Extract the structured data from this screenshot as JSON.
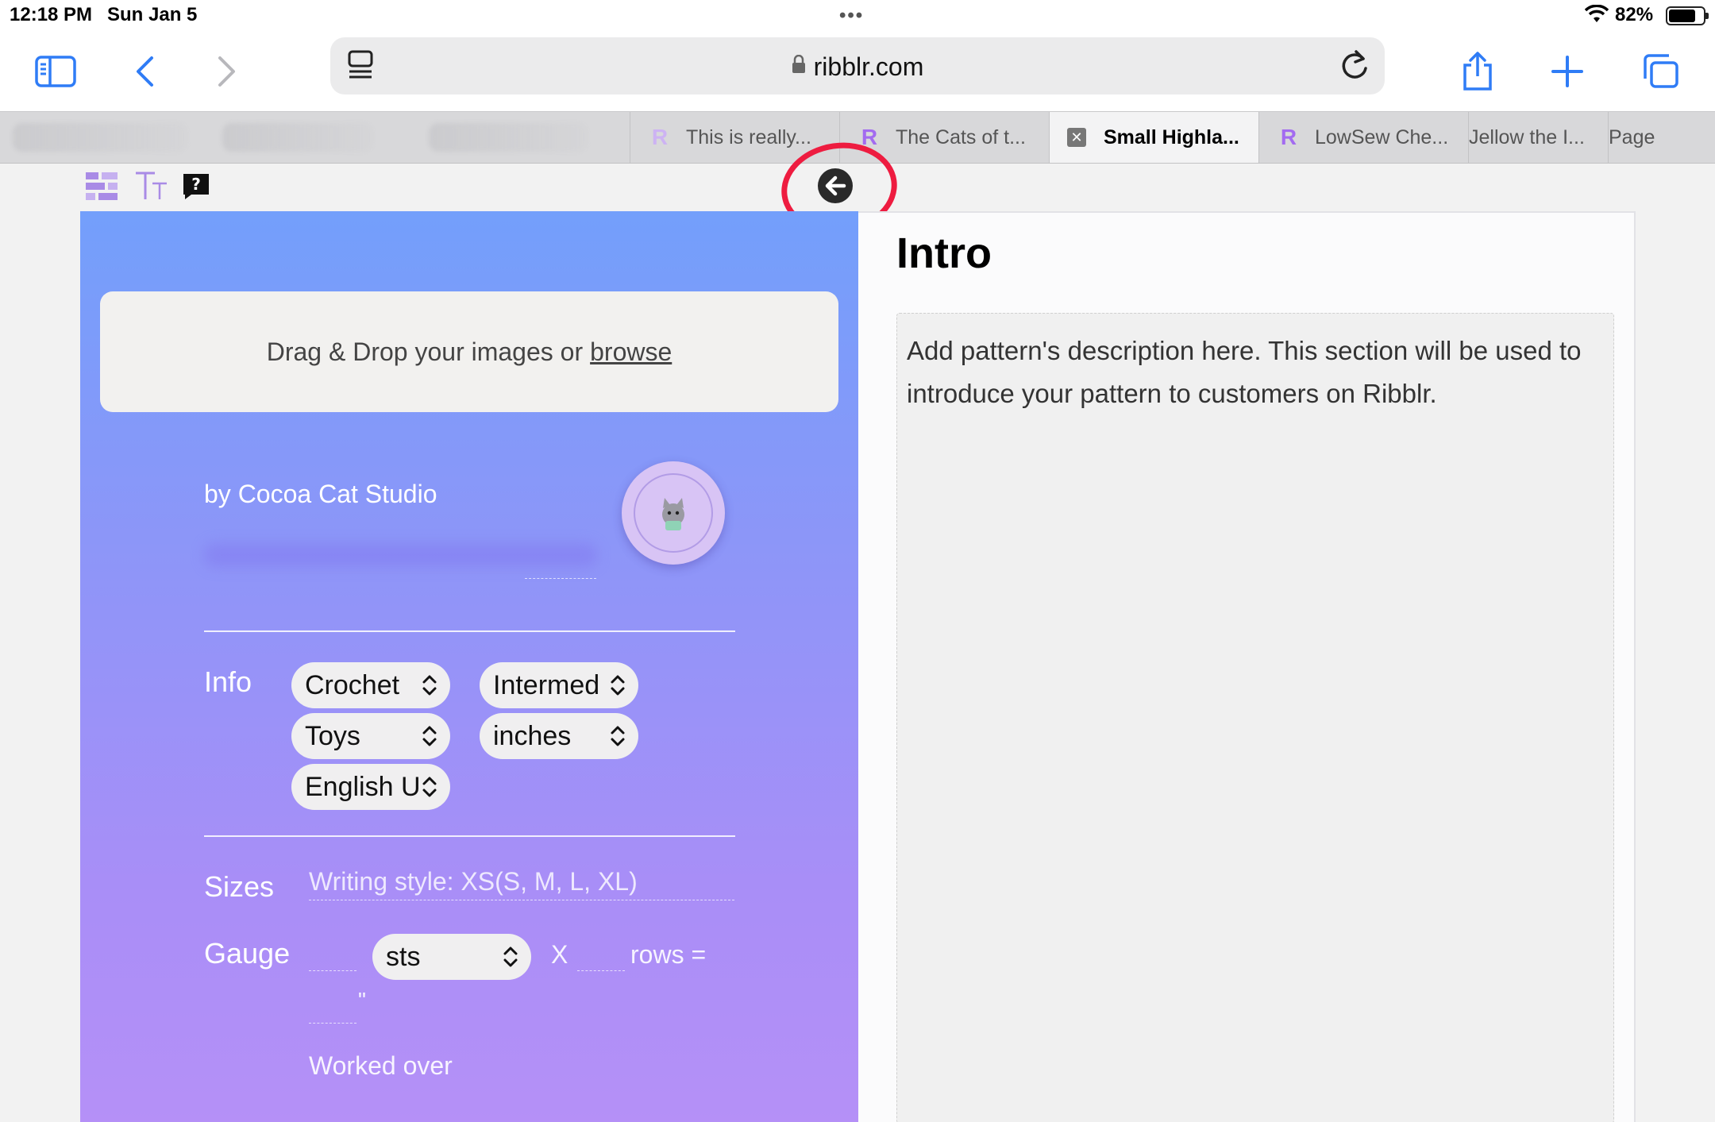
{
  "status_bar": {
    "time": "12:18 PM",
    "date": "Sun Jan 5",
    "battery_percent": "82%"
  },
  "browser": {
    "url": "ribblr.com",
    "tabs": [
      {
        "label": "This is really..."
      },
      {
        "label": "The Cats of t..."
      },
      {
        "label": "Small Highla...",
        "active": true
      },
      {
        "label": "LowSew Che..."
      },
      {
        "label": "Jellow the I..."
      },
      {
        "label": "Page"
      }
    ]
  },
  "editor": {
    "help_icon_text": "?"
  },
  "left_card": {
    "dropzone_text": "Drag & Drop your images or",
    "dropzone_link": "browse",
    "byline": "by Cocoa Cat Studio",
    "info": {
      "label": "Info",
      "selects": {
        "craft": "Crochet",
        "difficulty": "Intermed",
        "category": "Toys",
        "units": "inches",
        "language": "English U"
      }
    },
    "sizes": {
      "label": "Sizes",
      "placeholder": "Writing style: XS(S, M, L, XL)"
    },
    "gauge": {
      "label": "Gauge",
      "stitch_unit": "sts",
      "x_label": "X",
      "rows_label": "rows =",
      "inch_mark": "\"",
      "worked_over": "Worked over"
    }
  },
  "right_panel": {
    "title": "Intro",
    "description": "Add pattern's description here. This section will be used to introduce your pattern to customers on Ribblr."
  },
  "colors": {
    "accent": "#2f7cf6",
    "annotation": "#ee1c40",
    "card_top": "#739ffb",
    "card_bottom": "#b590f7"
  }
}
